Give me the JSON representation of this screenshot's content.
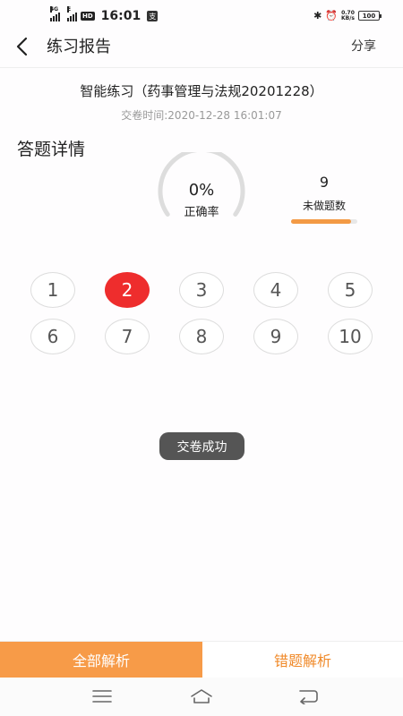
{
  "status_bar": {
    "network": "4G",
    "network2": "E",
    "hd": "HD",
    "time": "16:01",
    "app_badge": "支",
    "speed_value": "0.70",
    "speed_unit": "KB/s",
    "battery": "100"
  },
  "header": {
    "title": "练习报告",
    "share_label": "分享"
  },
  "report": {
    "exam_title": "智能练习（药事管理与法规20201228）",
    "submit_time": "交卷时间:2020-12-28 16:01:07",
    "section_title": "答题详情"
  },
  "score": {
    "accuracy_text": "0%",
    "accuracy_value": 0,
    "accuracy_label": "正确率"
  },
  "unanswered": {
    "count": "9",
    "label": "未做题数",
    "progress": 0.9
  },
  "questions": [
    {
      "num": "1",
      "active": false
    },
    {
      "num": "2",
      "active": true
    },
    {
      "num": "3",
      "active": false
    },
    {
      "num": "4",
      "active": false
    },
    {
      "num": "5",
      "active": false
    },
    {
      "num": "6",
      "active": false
    },
    {
      "num": "7",
      "active": false
    },
    {
      "num": "8",
      "active": false
    },
    {
      "num": "9",
      "active": false
    },
    {
      "num": "10",
      "active": false
    }
  ],
  "toast": "交卷成功",
  "actions": {
    "all_analysis": "全部解析",
    "wrong_analysis": "错题解析"
  },
  "colors": {
    "accent_orange": "#f79b48",
    "active_red": "#ee2d2d",
    "gauge_track": "#dddddd"
  }
}
